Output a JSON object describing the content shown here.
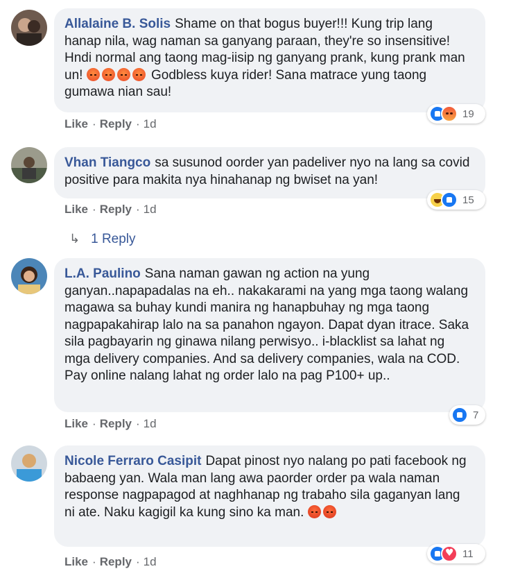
{
  "actions": {
    "like": "Like",
    "reply": "Reply",
    "separator": "·"
  },
  "comments": [
    {
      "author": "Allalaine B. Solis",
      "text_a": "Shame on that bogus buyer!!! Kung trip lang hanap nila, wag naman sa ganyang paraan, they're so insensitive! Hndi normal ang taong mag-iisip ng ganyang prank, kung prank man un!",
      "text_b": "Godbless kuya rider! Sana matrace yung taong gumawa nian sau!",
      "time": "1d",
      "reaction_types": [
        "like",
        "angry"
      ],
      "reaction_count": "19",
      "inline_emoji": [
        "angry-face",
        "angry-face",
        "angry-face",
        "angry-face"
      ]
    },
    {
      "author": "Vhan Tiangco",
      "text": "sa susunod oorder yan padeliver nyo na lang sa covid positive para makita nya hinahanap ng bwiset na yan!",
      "time": "1d",
      "reaction_types": [
        "haha",
        "like"
      ],
      "reaction_count": "15",
      "replies_label": "1 Reply"
    },
    {
      "author": "L.A. Paulino",
      "text": "Sana naman gawan ng action na yung ganyan..napapadalas na eh.. nakakarami na yang mga taong walang magawa sa buhay kundi manira ng hanapbuhay ng mga taong nagpapakahirap lalo na sa panahon ngayon. Dapat dyan itrace. Saka sila pagbayarin ng ginawa nilang perwisyo.. i-blacklist sa lahat ng mga delivery companies. And sa delivery companies, wala na COD. Pay online nalang lahat ng order lalo na pag P100+ up..",
      "time": "1d",
      "reaction_types": [
        "like"
      ],
      "reaction_count": "7"
    },
    {
      "author": "Nicole Ferraro Casipit",
      "text": "Dapat pinost nyo nalang po pati facebook ng babaeng yan. Wala man lang awa paorder order pa wala naman response nagpapagod at naghhanap ng trabaho sila gaganyan lang ni ate. Naku kagigil ka kung sino ka man.",
      "time": "1d",
      "reaction_types": [
        "like",
        "love"
      ],
      "reaction_count": "11",
      "inline_emoji": [
        "cursing-face",
        "cursing-face"
      ]
    }
  ]
}
